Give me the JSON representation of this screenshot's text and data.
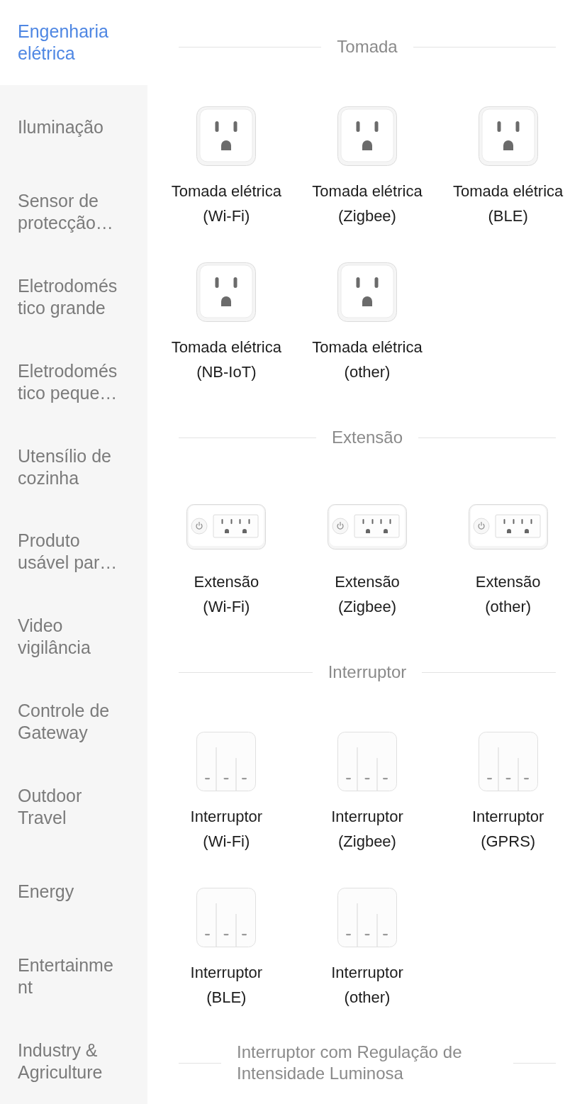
{
  "sidebar": {
    "items": [
      {
        "label": "Engenharia elétrica",
        "selected": true
      },
      {
        "label": "Iluminação",
        "selected": false
      },
      {
        "label": "Sensor de protecção…",
        "selected": false
      },
      {
        "label": "Eletrodoméstico grande",
        "selected": false
      },
      {
        "label": "Eletrodoméstico peque…",
        "selected": false
      },
      {
        "label": "Utensílio de cozinha",
        "selected": false
      },
      {
        "label": "Produto usável par…",
        "selected": false
      },
      {
        "label": "Video vigilância",
        "selected": false
      },
      {
        "label": "Controle de Gateway",
        "selected": false
      },
      {
        "label": "Outdoor Travel",
        "selected": false
      },
      {
        "label": "Energy",
        "selected": false
      },
      {
        "label": "Entertainment",
        "selected": false
      },
      {
        "label": "Industry & Agriculture",
        "selected": false
      }
    ]
  },
  "sections": [
    {
      "title": "Tomada",
      "products": [
        {
          "kind": "outlet",
          "name": "Tomada elétrica",
          "variant": "(Wi-Fi)"
        },
        {
          "kind": "outlet",
          "name": "Tomada elétrica",
          "variant": "(Zigbee)"
        },
        {
          "kind": "outlet",
          "name": "Tomada elétrica",
          "variant": "(BLE)"
        },
        {
          "kind": "outlet",
          "name": "Tomada elétrica",
          "variant": "(NB-IoT)"
        },
        {
          "kind": "outlet",
          "name": "Tomada elétrica",
          "variant": "(other)"
        }
      ]
    },
    {
      "title": "Extensão",
      "products": [
        {
          "kind": "power-strip",
          "name": "Extensão",
          "variant": "(Wi-Fi)"
        },
        {
          "kind": "power-strip",
          "name": "Extensão",
          "variant": "(Zigbee)"
        },
        {
          "kind": "power-strip",
          "name": "Extensão",
          "variant": "(other)"
        }
      ]
    },
    {
      "title": "Interruptor",
      "products": [
        {
          "kind": "switch",
          "name": "Interruptor",
          "variant": "(Wi-Fi)"
        },
        {
          "kind": "switch",
          "name": "Interruptor",
          "variant": "(Zigbee)"
        },
        {
          "kind": "switch",
          "name": "Interruptor",
          "variant": "(GPRS)"
        },
        {
          "kind": "switch",
          "name": "Interruptor",
          "variant": "(BLE)"
        },
        {
          "kind": "switch",
          "name": "Interruptor",
          "variant": "(other)"
        }
      ]
    },
    {
      "title": "Interruptor com Regulação de Intensidade Luminosa"
    }
  ]
}
